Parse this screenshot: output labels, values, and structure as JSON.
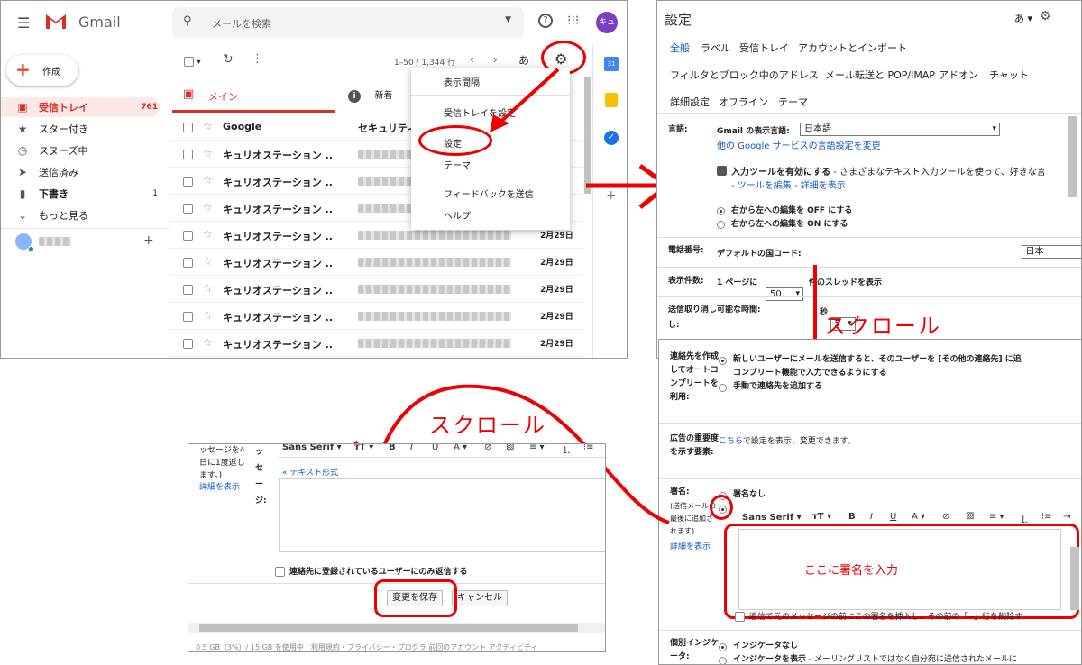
{
  "gmail": {
    "logo_text": "Gmail",
    "search_placeholder": "メールを検索",
    "avatar_text": "キュ",
    "compose_label": "作成",
    "sidebar": [
      {
        "label": "受信トレイ",
        "count": "761",
        "icon": "inbox-icon"
      },
      {
        "label": "スター付き",
        "count": "",
        "icon": "star-icon"
      },
      {
        "label": "スヌーズ中",
        "count": "",
        "icon": "clock-icon"
      },
      {
        "label": "送信済み",
        "count": "",
        "icon": "send-icon"
      },
      {
        "label": "下書き",
        "count": "1",
        "icon": "draft-icon"
      },
      {
        "label": "もっと見る",
        "count": "",
        "icon": "chevron-down-icon"
      }
    ],
    "pagination": "1–50 / 1,344 行",
    "lang_button": "あ",
    "tabs": {
      "main": "メイン",
      "new": "新着"
    },
    "rows": [
      {
        "sender": "Google",
        "subject": "セキュリティ",
        "date": ""
      },
      {
        "sender": "キュリオステーション ..",
        "subject": "",
        "date": ""
      },
      {
        "sender": "キュリオステーション ..",
        "subject": "",
        "date": ""
      },
      {
        "sender": "キュリオステーション ..",
        "subject": "",
        "date": ""
      },
      {
        "sender": "キュリオステーション ..",
        "subject": "",
        "date": "2月29日"
      },
      {
        "sender": "キュリオステーション ..",
        "subject": "",
        "date": "2月29日"
      },
      {
        "sender": "キュリオステーション ..",
        "subject": "",
        "date": "2月29日"
      },
      {
        "sender": "キュリオステーション ..",
        "subject": "",
        "date": "2月29日"
      },
      {
        "sender": "キュリオステーション ..",
        "subject": "",
        "date": "2月29日"
      }
    ],
    "menu": [
      "表示間隔",
      "受信トレイを設定",
      "設定",
      "テーマ",
      "フィードバックを送信",
      "ヘルプ"
    ]
  },
  "settings": {
    "title": "設定",
    "lang_button": "あ",
    "tabs_row1": [
      "全般",
      "ラベル",
      "受信トレイ",
      "アカウントとインポート"
    ],
    "tabs_row2": [
      "フィルタとブロック中のアドレス",
      "メール転送と POP/IMAP",
      "アドオン",
      "チャット"
    ],
    "tabs_row3": [
      "詳細設定",
      "オフライン",
      "テーマ"
    ],
    "language_label": "言語:",
    "display_lang_label": "Gmail の表示言語:",
    "display_lang_value": "日本語",
    "other_lang_link": "他の Google サービスの言語設定を変更",
    "input_tools_bold": "入力ツールを有効にする",
    "input_tools_rest": " - さまざまなテキスト入力ツールを使って、好きな言",
    "input_tools_link": "- ツールを編集 - 詳細を表示",
    "rtl_off": "右から左への編集を OFF にする",
    "rtl_on": "右から左への編集を ON にする",
    "phone_label": "電話番号:",
    "phone_text": "デフォルトの国コード:",
    "phone_value": "日本",
    "page_size_label": "表示件数:",
    "page_size_pre": "1 ページに",
    "page_size_value": "50",
    "page_size_post": "件のスレッドを表示",
    "undo_label": "送信取り消し可能な時間:",
    "undo_value": "5",
    "undo_unit": "秒",
    "undo_tail": "し:"
  },
  "settings2": {
    "contacts_label": "連絡先を作成してオートコンプリートを利用:",
    "contacts_opt1": "新しいユーザーにメールを送信すると、そのユーザーを [その他の連絡先] に追",
    "contacts_opt1b": "コンプリート機能で入力できるようにする",
    "contacts_opt2": "手動で連絡先を追加する",
    "ads_label": "広告の重要度を示す要素:",
    "ads_link": "こちら",
    "ads_text": "で設定を表示、変更できます。",
    "sig_label": "署名:",
    "sig_note": "(送信メールの最後に追加されます)",
    "sig_more": "詳細を表示",
    "sig_none": "署名なし",
    "font_name": "Sans Serif",
    "sig_placeholder": "ここに署名を入力",
    "sig_insert": "返信で元のメッセージの前にこの署名を挿入し、その前の「--」行を削除す",
    "indicator_label": "個別インジケータ:",
    "indicator_off": "インジケータなし",
    "indicator_on": "インジケータを表示",
    "indicator_on_rest": " - メーリングリストではなく自分宛に送信されたメールに"
  },
  "settings3": {
    "vacation_note": "ッセージを4日に1度返します。)",
    "more_link": "詳細を表示",
    "msg_label": "ッセージ:",
    "font_name": "Sans Serif",
    "text_format_link": "« テキスト形式",
    "contacts_only": "連絡先に登録されているユーザーにのみ返信する",
    "save_button": "変更を保存",
    "cancel_button": "キャンセル",
    "footer": "0.5 GB（3%）/ 15 GB を使用中　利用規約・プライバシー・プログラ 前回のアカウント アクティビティ"
  },
  "annotations": {
    "scroll1": "スクロール",
    "scroll2": "スクロール"
  },
  "colors": {
    "annotation_red": "#e00000",
    "gmail_red": "#d93025",
    "link_blue": "#1155cc",
    "selected_bg": "#fce8e6"
  }
}
